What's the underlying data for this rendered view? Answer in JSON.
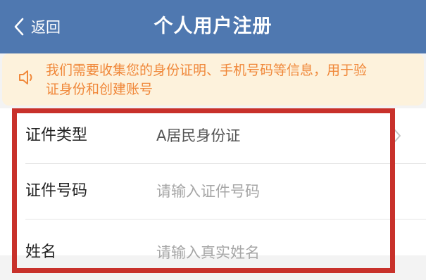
{
  "header": {
    "back_label": "返回",
    "title": "个人用户注册",
    "background_color": "#4f78b0"
  },
  "notice": {
    "icon": "speaker-icon",
    "text_line1": "我们需要收集您的身份证明、手机号码等信息，用于验",
    "text_line2": "证身份和创建账号",
    "text_color": "#f0883a",
    "background_color": "#fdf2dc"
  },
  "form": {
    "rows": [
      {
        "label": "证件类型",
        "value": "A居民身份证",
        "placeholder": ""
      },
      {
        "label": "证件号码",
        "value": "",
        "placeholder": "请输入证件号码"
      },
      {
        "label": "姓名",
        "value": "",
        "placeholder": "请输入真实姓名"
      }
    ]
  },
  "highlight": {
    "color": "#c8312b"
  }
}
